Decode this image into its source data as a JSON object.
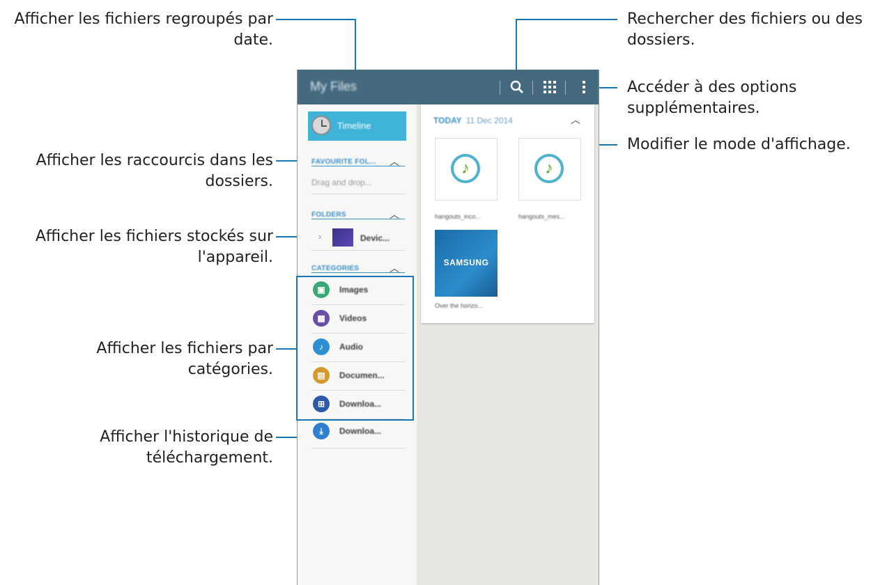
{
  "callouts": {
    "group_by_date": [
      "Afficher les fichiers regroupés par",
      "date."
    ],
    "shortcuts": [
      "Afficher les raccourcis dans les",
      "dossiers."
    ],
    "device_files": [
      "Afficher les fichiers stockés sur",
      "l'appareil."
    ],
    "categories": [
      "Afficher les fichiers par",
      "catégories."
    ],
    "download_history": [
      "Afficher l'historique de",
      "téléchargement."
    ],
    "search": [
      "Rechercher des fichiers ou des",
      "dossiers."
    ],
    "more_options": [
      "Accéder à des options",
      "supplémentaires."
    ],
    "view_mode": [
      "Modifier le mode d'affichage."
    ]
  },
  "app": {
    "title": "My Files",
    "timeline_label": "Timeline",
    "favourite_header": "FAVOURITE FOL...",
    "favourite_placeholder": "Drag and drop...",
    "folders_header": "FOLDERS",
    "folder_item": "Devic...",
    "categories_header": "CATEGORIES",
    "categories": [
      {
        "label": "Images",
        "icon": "image-icon",
        "color": "#3aa776",
        "glyph": "▣"
      },
      {
        "label": "Videos",
        "icon": "video-icon",
        "color": "#6a4fa6",
        "glyph": "▦"
      },
      {
        "label": "Audio",
        "icon": "music-note-icon",
        "color": "#2f8fd0",
        "glyph": "♪"
      },
      {
        "label": "Documen...",
        "icon": "document-icon",
        "color": "#d59a2b",
        "glyph": "▤"
      },
      {
        "label": "Downloa...",
        "icon": "apps-download-icon",
        "color": "#2d5aa8",
        "glyph": "⊞"
      }
    ],
    "download_history_label": "Downloa...",
    "today_label": "TODAY",
    "today_date": "11 Dec 2014",
    "files": [
      {
        "name": "hangouts_inco...",
        "icon": "music-note-icon"
      },
      {
        "name": "hangouts_mes...",
        "icon": "music-note-icon"
      },
      {
        "name": "Over the horizo...",
        "icon": "samsung-image-icon",
        "thumb_text": "SAMSUNG"
      }
    ]
  },
  "colors": {
    "appbar": "#456a80",
    "timeline": "#3fb3d8",
    "accent": "#3a8fc8",
    "leader": "#1677b5"
  }
}
